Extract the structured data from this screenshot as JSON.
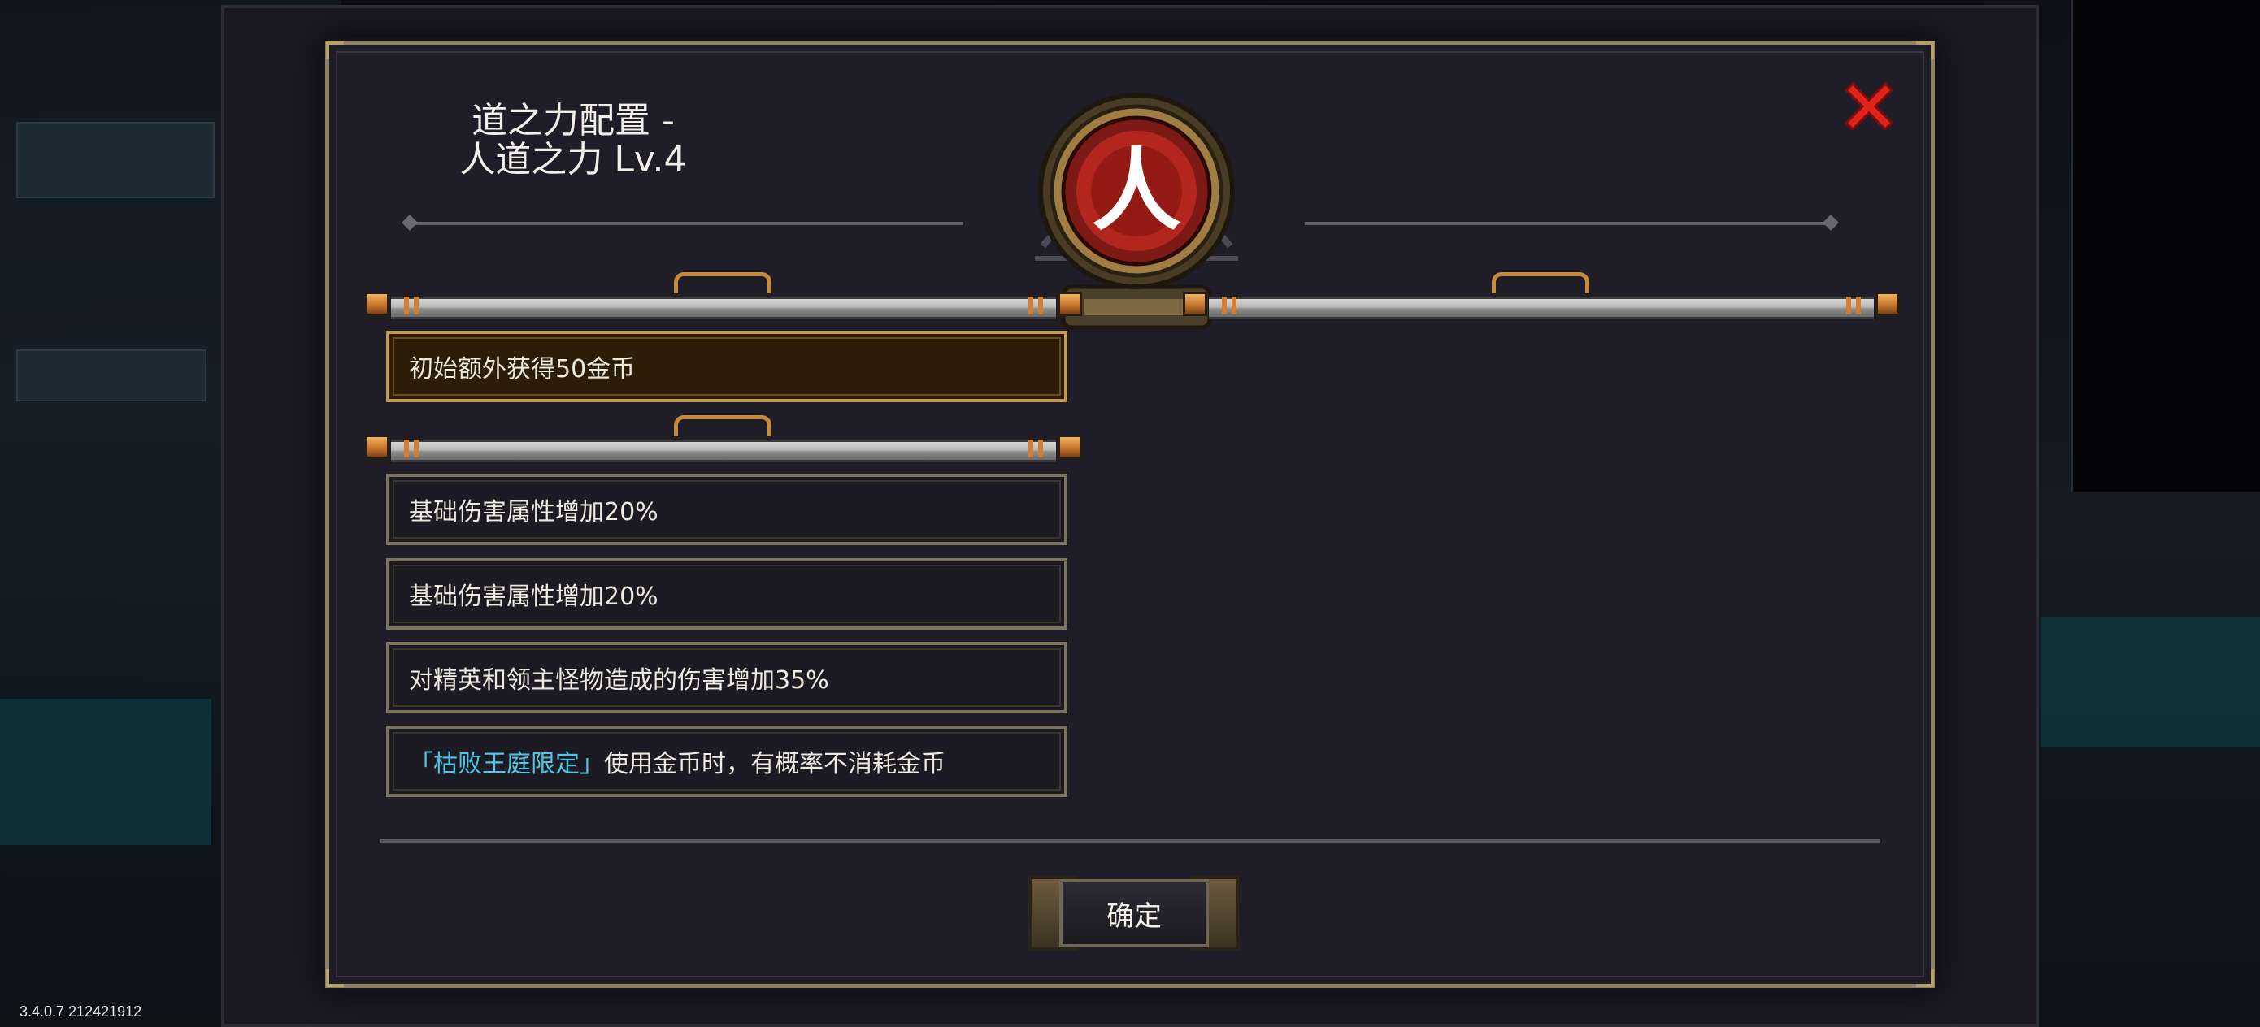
{
  "dialog": {
    "title_line1": "道之力配置 -",
    "title_line2": "人道之力 Lv.4",
    "emblem_glyph": "人",
    "close_icon": "close-icon"
  },
  "options": {
    "selected": {
      "text": "初始额外获得50金币"
    },
    "items": [
      {
        "text": "基础伤害属性增加20%"
      },
      {
        "text": "基础伤害属性增加20%"
      },
      {
        "text": "对精英和领主怪物造成的伤害增加35%"
      },
      {
        "tag": "「枯败王庭限定」",
        "text": "使用金币时，有概率不消耗金币"
      }
    ]
  },
  "footer": {
    "confirm_label": "确定"
  },
  "version": "3.4.0.7 212421912",
  "colors": {
    "frame": "#8d8262",
    "selected_bg": "#2c1c08",
    "tag": "#4cc7e6",
    "close": "#e0241c",
    "emblem_red": "#b3261e"
  }
}
